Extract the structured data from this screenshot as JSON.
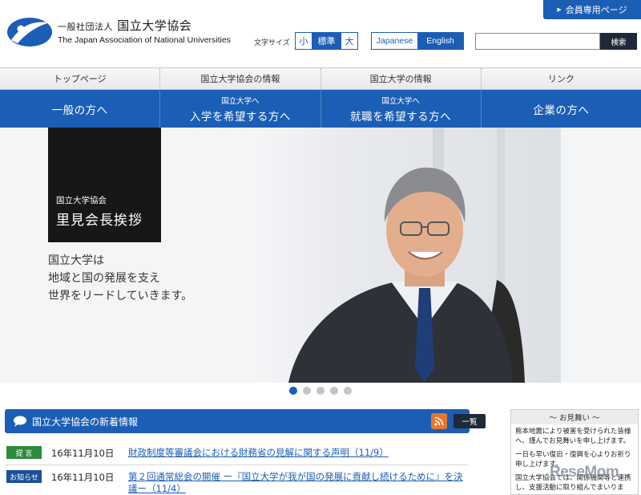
{
  "header": {
    "org_type": "一般社団法人",
    "org_name": "国立大学協会",
    "org_name_en": "The Japan Association of National Universities",
    "member_button": "会員専用ページ",
    "font_size_label": "文字サイズ",
    "font_sizes": [
      "小",
      "標準",
      "大"
    ],
    "languages": [
      "Japanese",
      "English"
    ],
    "search_placeholder": "",
    "search_button": "検索"
  },
  "nav_secondary": [
    "トップページ",
    "国立大学協会の情報",
    "国立大学の情報",
    "リンク"
  ],
  "nav_primary": [
    {
      "sub": "",
      "label": "一般の方へ"
    },
    {
      "sub": "国立大学へ",
      "label": "入学を希望する方へ"
    },
    {
      "sub": "国立大学へ",
      "label": "就職を希望する方へ"
    },
    {
      "sub": "",
      "label": "企業の方へ"
    }
  ],
  "hero": {
    "card_sub": "国立大学協会",
    "card_title": "里見会長挨拶",
    "lines": [
      "国立大学は",
      "地域と国の発展を支え",
      "世界をリードしていきます。"
    ],
    "slide_count": 5,
    "active_slide": 0
  },
  "news": {
    "title": "国立大学協会の新着情報",
    "all_button": "一覧",
    "items": [
      {
        "badge": "提 言",
        "badge_color": "#2e8b3d",
        "date": "16年11月10日",
        "text": "財政制度等審議会における財務省の見解に関する声明（11/9）"
      },
      {
        "badge": "お知らせ",
        "badge_color": "#1b4f9c",
        "date": "16年11月10日",
        "text": "第２回通常総会の開催 ー『国立大学が我が国の発展に貢献し続けるために』を決議ー（11/4）"
      }
    ]
  },
  "sidebar": {
    "title": "～ お見舞い ～",
    "paragraphs": [
      "熊本地震により被害を受けられた皆様へ、謹んでお見舞いを申し上げます。",
      "一日も早い復旧・復興を心よりお祈り申し上げます。",
      "国立大学協会では、関係機関等と連携し、支援活動に取り組んでまいります。"
    ]
  },
  "watermark": "ReseMom",
  "colors": {
    "brand_blue": "#1b5eb5",
    "dark": "#1e2a3a",
    "rss_orange": "#e8762b"
  }
}
